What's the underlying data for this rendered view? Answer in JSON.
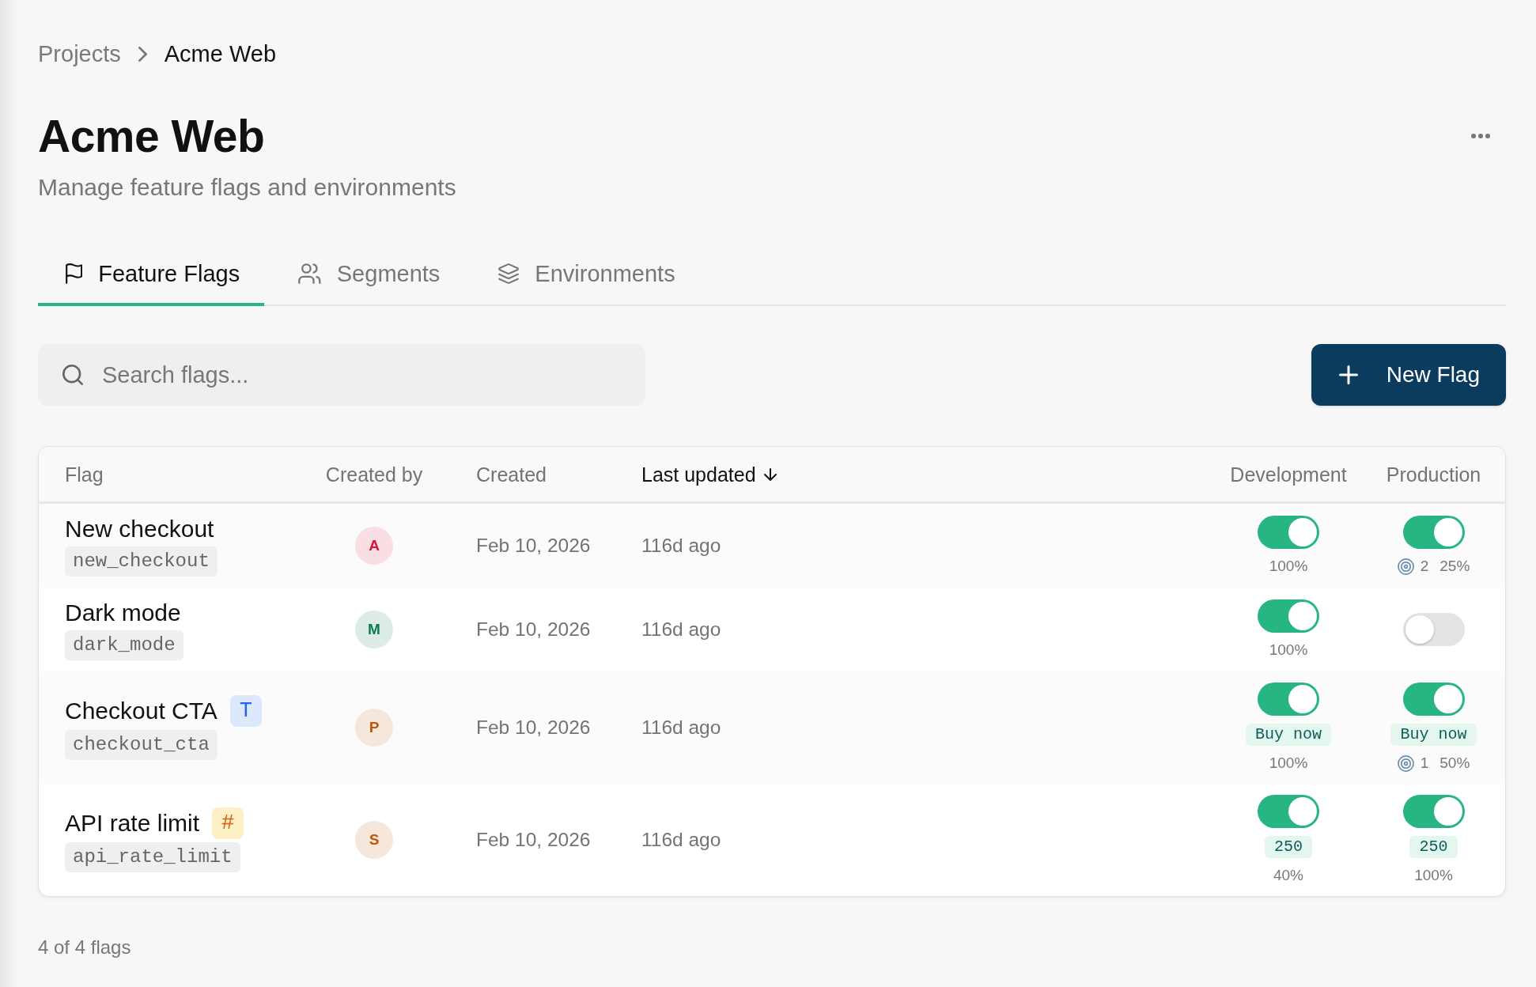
{
  "breadcrumb": [
    {
      "label": "Projects",
      "current": false
    },
    {
      "label": "Acme Web",
      "current": true
    }
  ],
  "header": {
    "title": "Acme Web",
    "subtitle": "Manage feature flags and environments"
  },
  "tabs": [
    {
      "label": "Feature Flags",
      "selected": true
    },
    {
      "label": "Segments",
      "selected": false
    },
    {
      "label": "Environments",
      "selected": false
    }
  ],
  "search": {
    "placeholder": "Search flags..."
  },
  "new_flag_button": {
    "label": "New Flag"
  },
  "table": {
    "columns": [
      {
        "label": "Flag",
        "kind": "text",
        "sorted": false
      },
      {
        "label": "Created by",
        "kind": "person",
        "sorted": false
      },
      {
        "label": "Created",
        "kind": "text",
        "sorted": false
      },
      {
        "label": "Last updated",
        "kind": "text",
        "sorted": true
      },
      {
        "label": "Development",
        "kind": "environment",
        "sorted": false
      },
      {
        "label": "Production",
        "kind": "environment",
        "sorted": false
      }
    ],
    "rows": [
      {
        "name": "New checkout",
        "key": "new_checkout",
        "creator": {
          "initial": "A",
          "color": "#d4163c"
        },
        "created": "Feb 10, 2026",
        "updated": "116d ago",
        "environments": [
          {
            "on": true,
            "rollout": "100%"
          },
          {
            "on": true,
            "targeting_rules": "2",
            "rollout": "25%"
          }
        ]
      },
      {
        "name": "Dark mode",
        "key": "dark_mode",
        "creator": {
          "initial": "M",
          "color": "#0b7a4e"
        },
        "created": "Feb 10, 2026",
        "updated": "116d ago",
        "environments": [
          {
            "on": true,
            "rollout": "100%"
          },
          {
            "on": false
          }
        ]
      },
      {
        "name": "Checkout CTA",
        "type": {
          "kind": "string",
          "symbol": "T"
        },
        "key": "checkout_cta",
        "creator": {
          "initial": "P",
          "color": "#c2570c"
        },
        "created": "Feb 10, 2026",
        "updated": "116d ago",
        "environments": [
          {
            "on": true,
            "variant": "Buy now",
            "rollout": "100%"
          },
          {
            "on": true,
            "variant": "Buy now",
            "targeting_rules": "1",
            "rollout": "50%"
          }
        ]
      },
      {
        "name": "API rate limit",
        "type": {
          "kind": "number",
          "symbol": "#"
        },
        "key": "api_rate_limit",
        "creator": {
          "initial": "S",
          "color": "#c2570c"
        },
        "created": "Feb 10, 2026",
        "updated": "116d ago",
        "environments": [
          {
            "on": true,
            "variant": "250",
            "rollout": "40%"
          },
          {
            "on": true,
            "variant": "250",
            "rollout": "100%"
          }
        ]
      }
    ]
  },
  "footer": {
    "count": "4 of 4 flags"
  }
}
